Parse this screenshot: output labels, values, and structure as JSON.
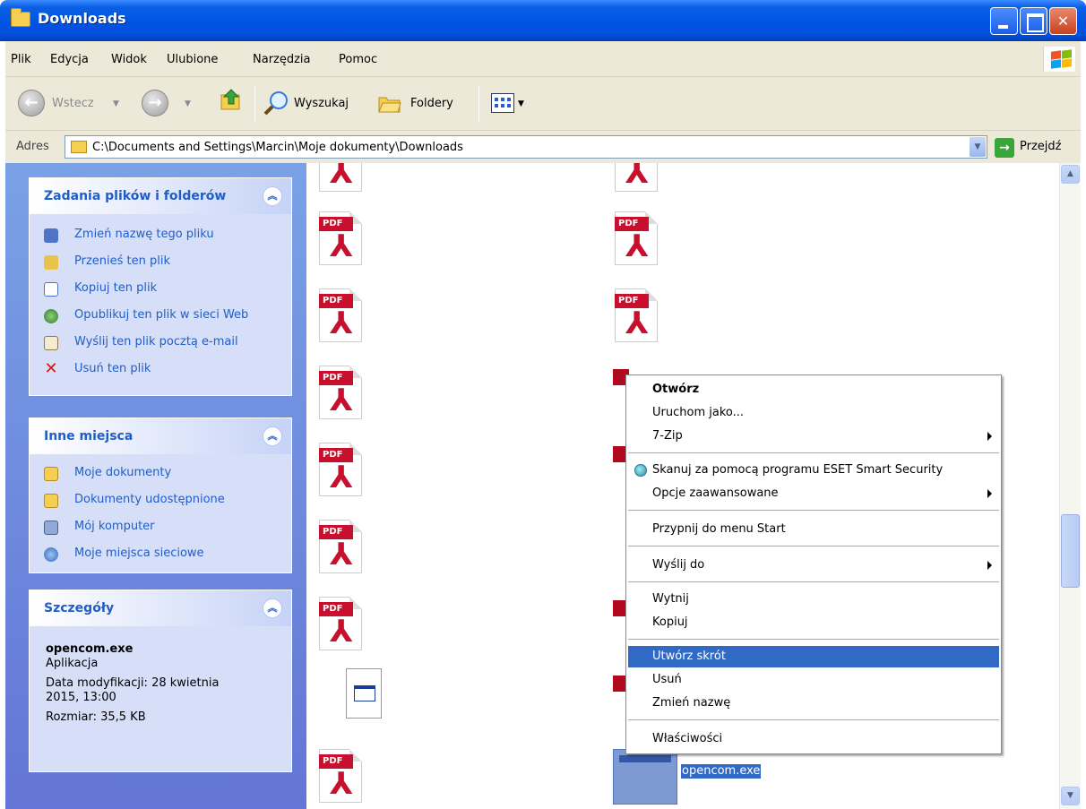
{
  "window": {
    "title": "Downloads"
  },
  "menubar": {
    "items": [
      "Plik",
      "Edycja",
      "Widok",
      "Ulubione",
      "Narzędzia",
      "Pomoc"
    ]
  },
  "toolbar": {
    "back_label": "Wstecz",
    "search_label": "Wyszukaj",
    "folders_label": "Foldery"
  },
  "address": {
    "label": "Adres",
    "value": "C:\\Documents and Settings\\Marcin\\Moje dokumenty\\Downloads",
    "go_label": "Przejdź"
  },
  "sidebar": {
    "tasks": {
      "title": "Zadania plików i folderów",
      "items": [
        {
          "label": "Zmień nazwę tego pliku",
          "icon": "rename-icon"
        },
        {
          "label": "Przenieś ten plik",
          "icon": "move-icon"
        },
        {
          "label": "Kopiuj ten plik",
          "icon": "copy-icon"
        },
        {
          "label": "Opublikuj ten plik w sieci Web",
          "icon": "publish-icon"
        },
        {
          "label": "Wyślij ten plik pocztą e-mail",
          "icon": "email-icon"
        },
        {
          "label": "Usuń ten plik",
          "icon": "delete-icon"
        }
      ]
    },
    "places": {
      "title": "Inne miejsca",
      "items": [
        {
          "label": "Moje dokumenty",
          "icon": "folder-icon"
        },
        {
          "label": "Dokumenty udostępnione",
          "icon": "folder-icon"
        },
        {
          "label": "Mój komputer",
          "icon": "computer-icon"
        },
        {
          "label": "Moje miejsca sieciowe",
          "icon": "network-icon"
        }
      ]
    },
    "details": {
      "title": "Szczegóły",
      "filename": "opencom.exe",
      "type": "Aplikacja",
      "modified_line1": "Data modyfikacji: 28 kwietnia",
      "modified_line2": "2015, 13:00",
      "size": "Rozmiar: 35,5 KB"
    }
  },
  "files": {
    "pdf_tag": "PDF",
    "selected_name": "opencom.exe"
  },
  "context_menu": {
    "items": [
      {
        "label": "Otwórz",
        "bold": true
      },
      {
        "label": "Uruchom jako..."
      },
      {
        "label": "7-Zip",
        "submenu": true
      },
      {
        "label": "Skanuj za pomocą programu ESET Smart Security",
        "icon": "eset-icon"
      },
      {
        "label": "Opcje zaawansowane",
        "submenu": true
      },
      {
        "label": "Przypnij do menu Start"
      },
      {
        "label": "Wyślij do",
        "submenu": true
      },
      {
        "label": "Wytnij"
      },
      {
        "label": "Kopiuj"
      },
      {
        "label": "Utwórz skrót",
        "highlighted": true
      },
      {
        "label": "Usuń"
      },
      {
        "label": "Zmień nazwę"
      },
      {
        "label": "Właściwości"
      }
    ]
  },
  "colors": {
    "titlebar": "#0054e3",
    "highlight": "#316ac5",
    "task_link": "#215dc6",
    "pdf_red": "#c8102e"
  }
}
